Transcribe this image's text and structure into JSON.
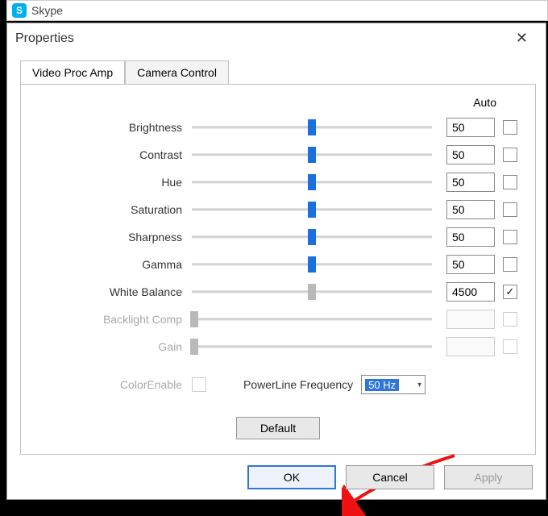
{
  "app": {
    "name": "Skype",
    "logo_letter": "S"
  },
  "dialog": {
    "title": "Properties",
    "tabs": [
      {
        "label": "Video Proc Amp",
        "active": true
      },
      {
        "label": "Camera Control",
        "active": false
      }
    ],
    "auto_header": "Auto",
    "sliders": [
      {
        "label": "Brightness",
        "value": "50",
        "pos": 50,
        "auto": false,
        "enabled": true
      },
      {
        "label": "Contrast",
        "value": "50",
        "pos": 50,
        "auto": false,
        "enabled": true
      },
      {
        "label": "Hue",
        "value": "50",
        "pos": 50,
        "auto": false,
        "enabled": true
      },
      {
        "label": "Saturation",
        "value": "50",
        "pos": 50,
        "auto": false,
        "enabled": true
      },
      {
        "label": "Sharpness",
        "value": "50",
        "pos": 50,
        "auto": false,
        "enabled": true
      },
      {
        "label": "Gamma",
        "value": "50",
        "pos": 50,
        "auto": false,
        "enabled": true
      },
      {
        "label": "White Balance",
        "value": "4500",
        "pos": 50,
        "auto": true,
        "enabled": true,
        "thumb_disabled": true
      },
      {
        "label": "Backlight Comp",
        "value": "",
        "pos": 1,
        "auto": false,
        "enabled": false
      },
      {
        "label": "Gain",
        "value": "",
        "pos": 1,
        "auto": false,
        "enabled": false
      }
    ],
    "color_enable_label": "ColorEnable",
    "powerline_label": "PowerLine Frequency",
    "powerline_value": "50 Hz",
    "default_button": "Default",
    "buttons": {
      "ok": "OK",
      "cancel": "Cancel",
      "apply": "Apply"
    }
  }
}
